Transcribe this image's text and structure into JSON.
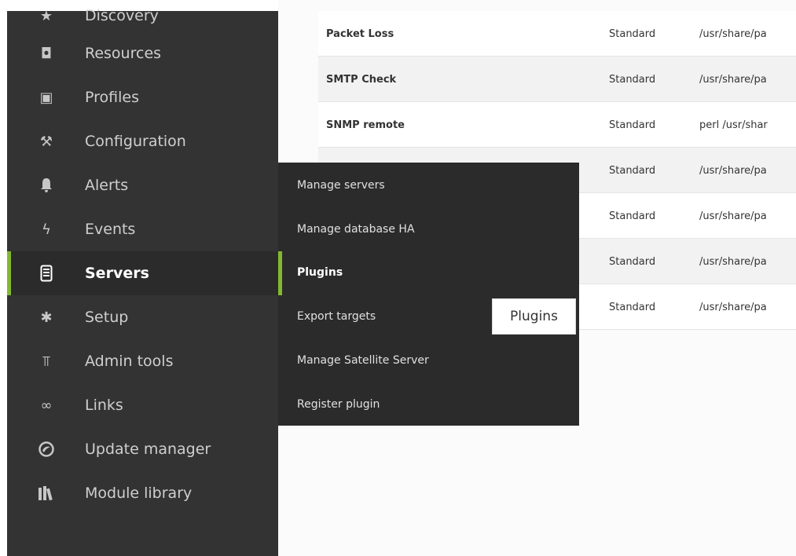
{
  "sidebar": {
    "items": [
      {
        "label": "Discovery",
        "icon": "star-icon",
        "glyph": "★"
      },
      {
        "label": "Resources",
        "icon": "resources-icon",
        "glyph": "◘"
      },
      {
        "label": "Profiles",
        "icon": "profile-icon",
        "glyph": "▣"
      },
      {
        "label": "Configuration",
        "icon": "wrench-icon",
        "glyph": "⚒"
      },
      {
        "label": "Alerts",
        "icon": "bell-icon",
        "glyph": "🔔"
      },
      {
        "label": "Events",
        "icon": "lightning-icon",
        "glyph": "ϟ"
      },
      {
        "label": "Servers",
        "icon": "server-icon",
        "glyph": "▤",
        "active": true
      },
      {
        "label": "Setup",
        "icon": "gear-icon",
        "glyph": "✱"
      },
      {
        "label": "Admin tools",
        "icon": "admin-tools-icon",
        "glyph": "⫪"
      },
      {
        "label": "Links",
        "icon": "link-icon",
        "glyph": "∞"
      },
      {
        "label": "Update manager",
        "icon": "update-icon",
        "glyph": "◉"
      },
      {
        "label": "Module library",
        "icon": "library-icon",
        "glyph": "Ⅲ"
      }
    ]
  },
  "flyout": {
    "items": [
      {
        "label": "Manage servers"
      },
      {
        "label": "Manage database HA"
      },
      {
        "label": "Plugins",
        "active": true
      },
      {
        "label": "Export targets"
      },
      {
        "label": "Manage Satellite Server"
      },
      {
        "label": "Register plugin"
      }
    ],
    "tooltip": "Plugins"
  },
  "table": {
    "rows": [
      {
        "name": "Packet Loss",
        "type": "Standard",
        "command": "/usr/share/pa"
      },
      {
        "name": "SMTP Check",
        "type": "Standard",
        "command": "/usr/share/pa"
      },
      {
        "name": "SNMP remote",
        "type": "Standard",
        "command": "perl /usr/shar"
      },
      {
        "name": "",
        "type": "Standard",
        "command": "/usr/share/pa"
      },
      {
        "name": "",
        "type": "Standard",
        "command": "/usr/share/pa"
      },
      {
        "name": "",
        "type": "Standard",
        "command": "/usr/share/pa"
      },
      {
        "name": "",
        "type": "Standard",
        "command": "/usr/share/pa"
      }
    ]
  },
  "colors": {
    "accent": "#82b92e",
    "sidebar_bg": "#333333",
    "flyout_bg": "#2b2b2b"
  }
}
